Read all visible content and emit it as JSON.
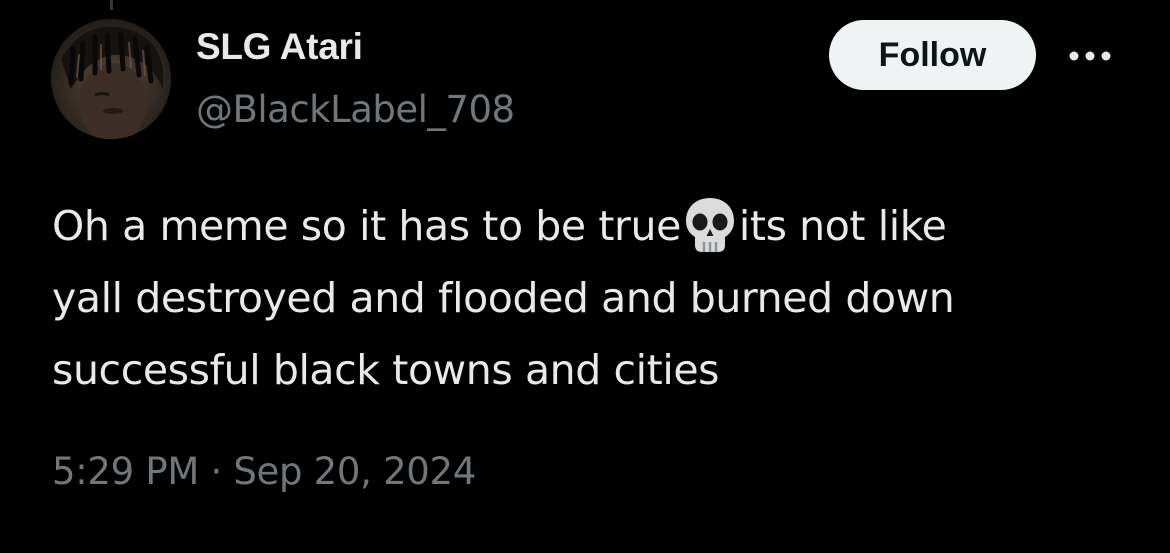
{
  "author": {
    "display_name": "SLG Atari",
    "handle": "@BlackLabel_708",
    "avatar": "profile-photo"
  },
  "actions": {
    "follow_label": "Follow",
    "more_icon": "more-horizontal-icon"
  },
  "tweet": {
    "text_lines": [
      {
        "before": "Oh a meme so it has to be true",
        "emoji": "skull-emoji",
        "after": "its not like"
      },
      {
        "text": "yall destroyed and flooded and burned down"
      },
      {
        "text": "successful black towns and cities"
      }
    ],
    "timestamp": "5:29 PM · Sep 20, 2024"
  },
  "colors": {
    "background": "#000000",
    "primary_text": "#e7e9ea",
    "secondary_text": "#71767b",
    "follow_bg": "#eff3f4",
    "follow_text": "#0f1419"
  }
}
